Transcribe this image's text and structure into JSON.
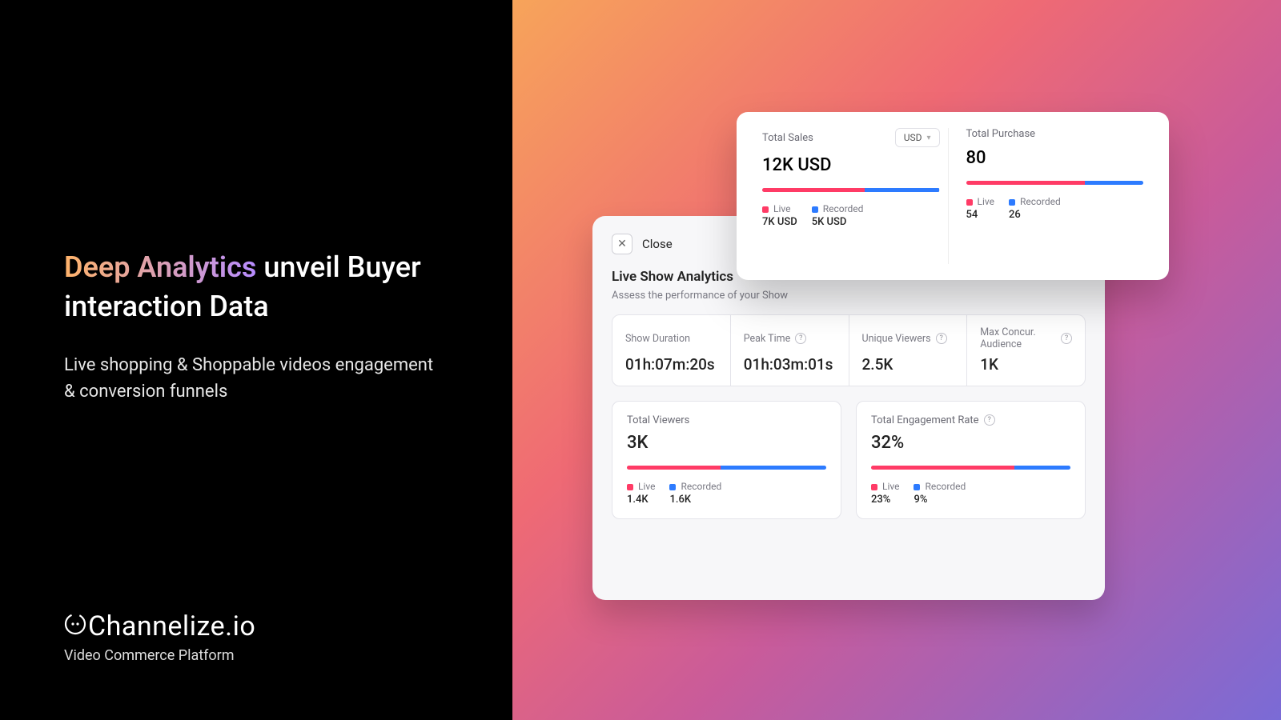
{
  "left": {
    "headline_highlight": "Deep Analytics",
    "headline_rest": " unveil Buyer interaction Data",
    "sub": "Live shopping & Shoppable videos engagement & conversion funnels",
    "brand": "Channelize.io",
    "tagline": "Video Commerce Platform"
  },
  "front": {
    "sales": {
      "label": "Total Sales",
      "currency": "USD",
      "value": "12K USD",
      "live_label": "Live",
      "live_value": "7K USD",
      "rec_label": "Recorded",
      "rec_value": "5K USD",
      "bar_red_pct": 58,
      "bar_blue_pct": 42
    },
    "purchase": {
      "label": "Total Purchase",
      "value": "80",
      "live_label": "Live",
      "live_value": "54",
      "rec_label": "Recorded",
      "rec_value": "26",
      "bar_red_pct": 67,
      "bar_blue_pct": 33
    }
  },
  "back": {
    "close": "Close",
    "title": "Live Show Analytics",
    "subtitle": "Assess the performance of your Show",
    "stats": {
      "duration_label": "Show Duration",
      "duration_value": "01h:07m:20s",
      "peak_label": "Peak Time",
      "peak_value": "01h:03m:01s",
      "unique_label": "Unique Viewers",
      "unique_value": "2.5K",
      "concur_label": "Max Concur. Audience",
      "concur_value": "1K"
    },
    "viewers": {
      "label": "Total Viewers",
      "value": "3K",
      "live_label": "Live",
      "live_value": "1.4K",
      "rec_label": "Recorded",
      "rec_value": "1.6K",
      "bar_red_pct": 47,
      "bar_blue_pct": 53
    },
    "engagement": {
      "label": "Total Engagement Rate",
      "value": "32%",
      "live_label": "Live",
      "live_value": "23%",
      "rec_label": "Recorded",
      "rec_value": "9%",
      "bar_red_pct": 72,
      "bar_blue_pct": 28
    }
  }
}
